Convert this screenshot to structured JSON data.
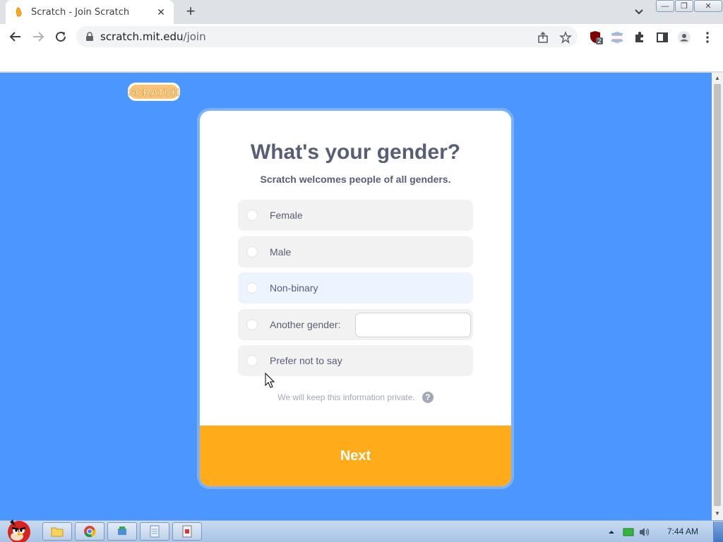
{
  "browser": {
    "tab": {
      "title": "Scratch - Join Scratch",
      "close_glyph": "✕"
    },
    "new_tab_glyph": "+",
    "window_controls": {
      "minimize": "—",
      "restore": "❐",
      "close": "✕"
    },
    "url": {
      "host": "scratch.mit.edu",
      "path": "/join"
    },
    "extension_badge": "2"
  },
  "page": {
    "logo_text": "SCRATCH",
    "title": "What's your gender?",
    "subtitle": "Scratch welcomes people of all genders.",
    "options": [
      {
        "label": "Female"
      },
      {
        "label": "Male"
      },
      {
        "label": "Non-binary"
      },
      {
        "label": "Another gender:"
      },
      {
        "label": "Prefer not to say"
      }
    ],
    "another_gender_input": {
      "value": "",
      "placeholder": ""
    },
    "privacy_note": "We will keep this information private.",
    "help_glyph": "?",
    "next_label": "Next",
    "colors": {
      "background": "#4c97ff",
      "next_button": "#ffab1a",
      "text": "#575e75"
    }
  },
  "taskbar": {
    "clock": "7:44 AM",
    "items": [
      "explorer",
      "chrome",
      "network-app",
      "notepad",
      "app"
    ]
  }
}
